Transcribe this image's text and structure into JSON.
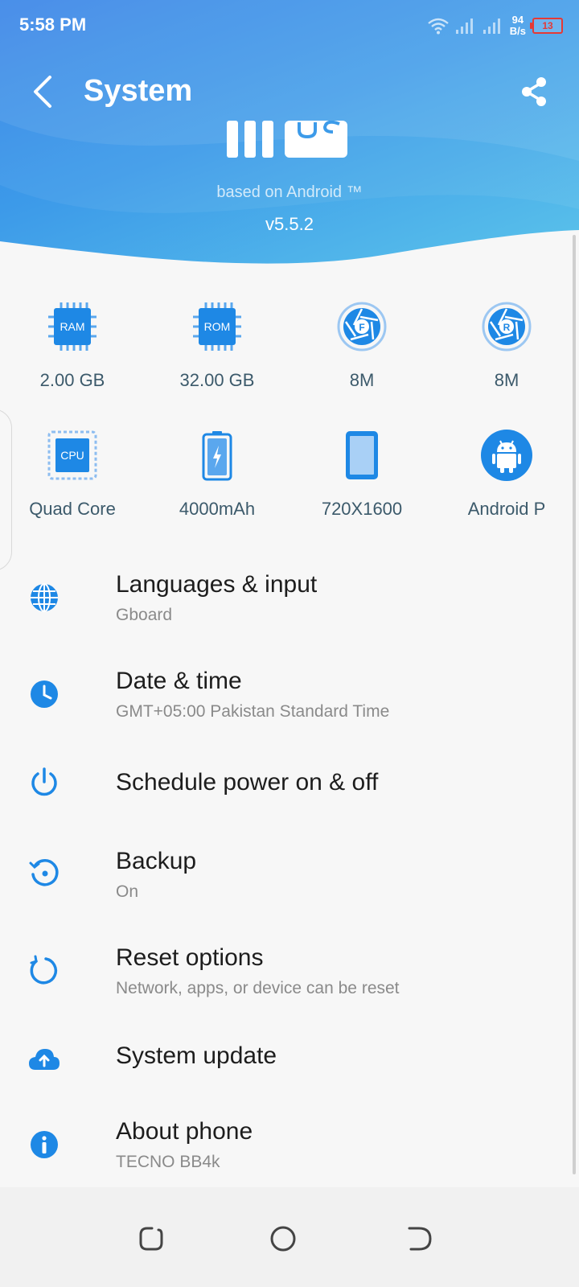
{
  "status_bar": {
    "time": "5:58 PM",
    "net_speed_value": "94",
    "net_speed_unit": "B/s",
    "battery_level": "13",
    "battery_color": "#e53935"
  },
  "toolbar": {
    "title": "System",
    "back_icon": "back-arrow-icon",
    "share_icon": "share-icon"
  },
  "header": {
    "based_on": "based on Android ™",
    "version": "v5.5.2",
    "gradient_start": "#2f7fe6",
    "gradient_end": "#5cc5ea"
  },
  "specs": [
    {
      "icon": "ram-chip-icon",
      "chip_text": "RAM",
      "label": "2.00 GB"
    },
    {
      "icon": "rom-chip-icon",
      "chip_text": "ROM",
      "label": "32.00 GB"
    },
    {
      "icon": "front-camera-icon",
      "chip_text": "F",
      "label": "8M"
    },
    {
      "icon": "rear-camera-icon",
      "chip_text": "R",
      "label": "8M"
    },
    {
      "icon": "cpu-icon",
      "chip_text": "CPU",
      "label": "Quad Core"
    },
    {
      "icon": "battery-icon",
      "chip_text": "",
      "label": "4000mAh"
    },
    {
      "icon": "screen-icon",
      "chip_text": "",
      "label": "720X1600"
    },
    {
      "icon": "android-icon",
      "chip_text": "",
      "label": "Android P"
    }
  ],
  "settings": [
    {
      "icon": "globe-icon",
      "title": "Languages & input",
      "subtitle": "Gboard"
    },
    {
      "icon": "clock-icon",
      "title": "Date & time",
      "subtitle": "GMT+05:00 Pakistan Standard Time"
    },
    {
      "icon": "power-icon",
      "title": "Schedule power on & off",
      "subtitle": ""
    },
    {
      "icon": "backup-icon",
      "title": "Backup",
      "subtitle": "On"
    },
    {
      "icon": "reset-icon",
      "title": "Reset options",
      "subtitle": "Network, apps, or device can be reset"
    },
    {
      "icon": "cloud-upload-icon",
      "title": "System update",
      "subtitle": ""
    },
    {
      "icon": "info-icon",
      "title": "About phone",
      "subtitle": "TECNO BB4k"
    }
  ],
  "navbar": {
    "recent_icon": "recents-icon",
    "home_icon": "home-icon",
    "back_icon": "nav-back-icon"
  },
  "accent_color": "#1e88e5"
}
